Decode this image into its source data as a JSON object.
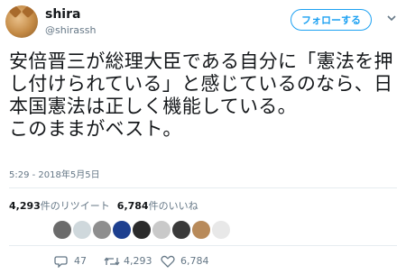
{
  "user": {
    "display_name": "shira",
    "handle": "@shirassh",
    "follow_label": "フォローする"
  },
  "tweet": {
    "text": "安倍晋三が総理大臣である自分に「憲法を押し付けられている」と感じているのなら、日本国憲法は正しく機能している。\nこのままがベスト。",
    "timestamp": "5:29 - 2018年5月5日"
  },
  "stats": {
    "retweets_count": "4,293",
    "retweets_label": "件のリツイート",
    "likes_count": "6,784",
    "likes_label": "件のいいね"
  },
  "likers": {
    "colors": [
      "#6b6b6b",
      "#cfd8dc",
      "#8e8e8e",
      "#1d3f8f",
      "#2b2b2b",
      "#c9c9c9",
      "#3a3a3a",
      "#b88a5a",
      "#e8e8e8"
    ]
  },
  "actions": {
    "reply_count": "47",
    "retweet_count": "4,293",
    "like_count": "6,784"
  },
  "colors": {
    "accent": "#1da1f2",
    "secondary_text": "#657786",
    "primary_text": "#14171a"
  }
}
